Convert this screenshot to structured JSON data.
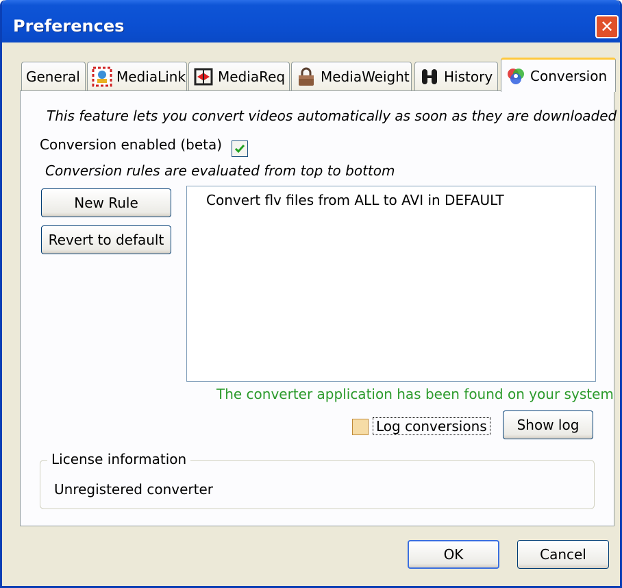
{
  "window": {
    "title": "Preferences"
  },
  "tabs": [
    {
      "label": "General",
      "icon": "none",
      "active": false
    },
    {
      "label": "MediaLink",
      "icon": "medialink-icon",
      "active": false
    },
    {
      "label": "MediaReq",
      "icon": "mediareq-icon",
      "active": false
    },
    {
      "label": "MediaWeight",
      "icon": "padlock-weight-icon",
      "active": false
    },
    {
      "label": "History",
      "icon": "history-icon",
      "active": false
    },
    {
      "label": "Conversion",
      "icon": "conversion-icon",
      "active": true
    }
  ],
  "conversion": {
    "description": "This feature lets you convert videos automatically as soon as they are downloaded",
    "enabled_label": "Conversion enabled (beta)",
    "enabled_checked": true,
    "rules_note": "Conversion rules are evaluated from top to bottom",
    "new_rule_button": "New Rule",
    "revert_button": "Revert to default",
    "rules": [
      "Convert flv files from ALL to AVI in DEFAULT"
    ],
    "converter_status": "The converter application has been found on your system",
    "log_label": "Log conversions",
    "log_checked": false,
    "show_log_button": "Show log",
    "license": {
      "title": "License information",
      "value": "Unregistered converter"
    }
  },
  "footer": {
    "ok_button": "OK",
    "cancel_button": "Cancel"
  },
  "colors": {
    "titlebar": "#0b4fd2",
    "status_green": "#2b9a2b",
    "active_tab_highlight": "#ffc83c",
    "close_button": "#e0502a"
  }
}
